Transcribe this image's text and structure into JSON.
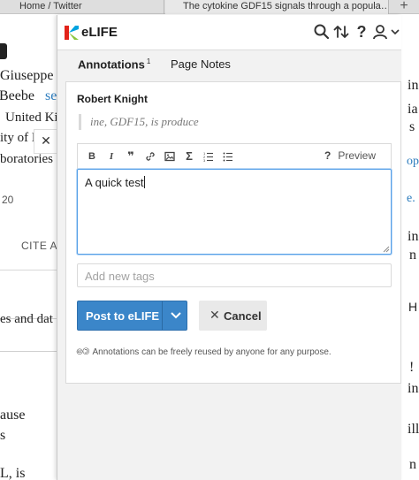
{
  "browser": {
    "tabs": [
      {
        "label": "Home / Twitter"
      },
      {
        "label": "The cytokine GDF15 signals through a popula…"
      }
    ],
    "new_tab_glyph": "+"
  },
  "article": {
    "left_fragments": [
      "Giuseppe",
      "Beebe",
      "se",
      "United Kin",
      "ity of N",
      "boratories",
      "20",
      "CITE AS",
      "es and dat",
      "ause",
      "s",
      "L, is"
    ],
    "right_fragments": [
      "in",
      "ia",
      "s",
      "ope",
      "e.",
      "in",
      "n",
      "H",
      "!",
      "in",
      "ill",
      "n"
    ],
    "close_glyph": "✕"
  },
  "sidebar": {
    "brand": "eLIFE",
    "logo_colors": [
      "#e2231a",
      "#00a3e0",
      "#8cc63f"
    ],
    "toolbar_icons": [
      "search-icon",
      "sort-icon",
      "help-icon",
      "user-icon",
      "chevron-down-icon"
    ],
    "help_glyph": "?",
    "tabs": [
      {
        "label": "Annotations",
        "count": "1",
        "active": true
      },
      {
        "label": "Page Notes",
        "active": false
      }
    ]
  },
  "annotation": {
    "author": "Robert Knight",
    "quote": "ine, GDF15, is produce",
    "editor_toolbar": {
      "buttons": [
        {
          "icon": "bold-icon",
          "glyph": "B"
        },
        {
          "icon": "italic-icon",
          "glyph": "I"
        },
        {
          "icon": "quote-icon",
          "glyph": "❞"
        },
        {
          "icon": "link-icon"
        },
        {
          "icon": "image-icon"
        },
        {
          "icon": "math-icon",
          "glyph": "Σ"
        },
        {
          "icon": "numbered-list-icon"
        },
        {
          "icon": "bullet-list-icon"
        }
      ],
      "preview_icon_glyph": "?",
      "preview_label": "Preview"
    },
    "body_text": "A quick test",
    "tags_placeholder": "Add new tags",
    "post_label": "Post to eLIFE",
    "cancel_label": "Cancel",
    "cancel_glyph": "✕",
    "license_icon": "cc-icon",
    "license_glyph": "🅭🄯",
    "license_text": "Annotations can be freely reused by anyone for any purpose.",
    "accent_color": "#3b86c9"
  }
}
